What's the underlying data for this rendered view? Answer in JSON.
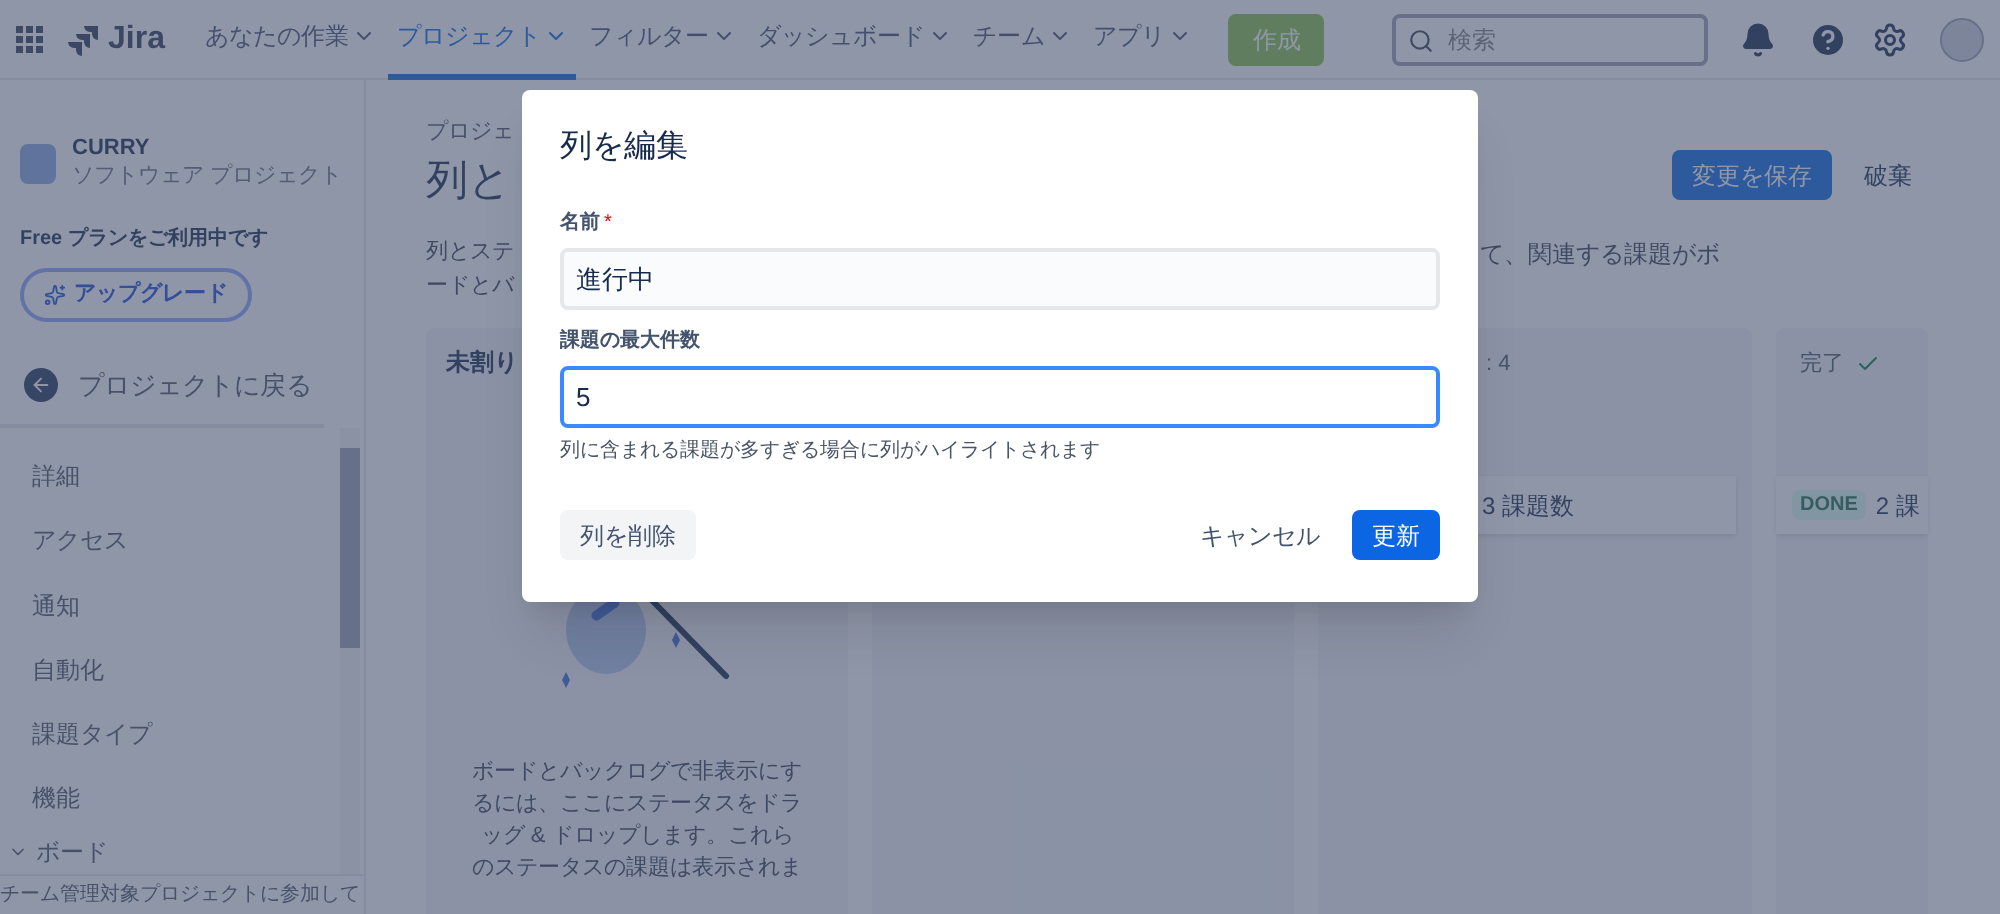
{
  "top_nav": {
    "app_name": "Jira",
    "items": [
      {
        "label": "あなたの作業",
        "selected": false
      },
      {
        "label": "プロジェクト",
        "selected": true
      },
      {
        "label": "フィルター",
        "selected": false
      },
      {
        "label": "ダッシュボード",
        "selected": false
      },
      {
        "label": "チーム",
        "selected": false
      },
      {
        "label": "アプリ",
        "selected": false
      }
    ],
    "create_button": "作成",
    "search": {
      "placeholder": "検索"
    }
  },
  "sidebar": {
    "project": {
      "name": "CURRY",
      "type": "ソフトウェア プロジェクト"
    },
    "plan_text": "Free プランをご利用中です",
    "upgrade_button": "アップグレード",
    "back_link": "プロジェクトに戻る",
    "items": [
      {
        "label": "詳細"
      },
      {
        "label": "アクセス"
      },
      {
        "label": "通知"
      },
      {
        "label": "自動化"
      },
      {
        "label": "課題タイプ"
      },
      {
        "label": "機能"
      }
    ],
    "group": {
      "label": "ボード",
      "expanded": true
    },
    "footer": "チーム管理対象プロジェクトに参加して"
  },
  "page": {
    "breadcrumb": "プロジェ",
    "title": "列と",
    "description_left": [
      "列とステ",
      "ードとバ"
    ],
    "description_right": "て、関連する課題がボ",
    "save_button": "変更を保存",
    "discard_button": "破棄"
  },
  "columns": [
    {
      "kind": "unassigned",
      "header": "未割り",
      "message": "ボードとバックログで非表示にするには、ここにステータスをドラッグ & ドロップします。これらのステータスの課題は表示されま"
    },
    {
      "kind": "blank"
    },
    {
      "kind": "status",
      "header": ": 4",
      "done": false,
      "cards": [
        {
          "text": "3 課題数"
        }
      ]
    },
    {
      "kind": "status",
      "header": "完了",
      "done": true,
      "cards": [
        {
          "badge": "DONE",
          "text": "2 課"
        }
      ]
    }
  ],
  "dialog": {
    "title": "列を編集",
    "fields": [
      {
        "label": "名前",
        "required_mark": "*",
        "value": "進行中",
        "focused": false
      },
      {
        "label": "課題の最大件数",
        "value": "5",
        "focused": true,
        "helper": "列に含まれる課題が多すぎる場合に列がハイライトされます"
      }
    ],
    "delete_button": "列を削除",
    "cancel_button": "キャンセル",
    "update_button": "更新"
  }
}
